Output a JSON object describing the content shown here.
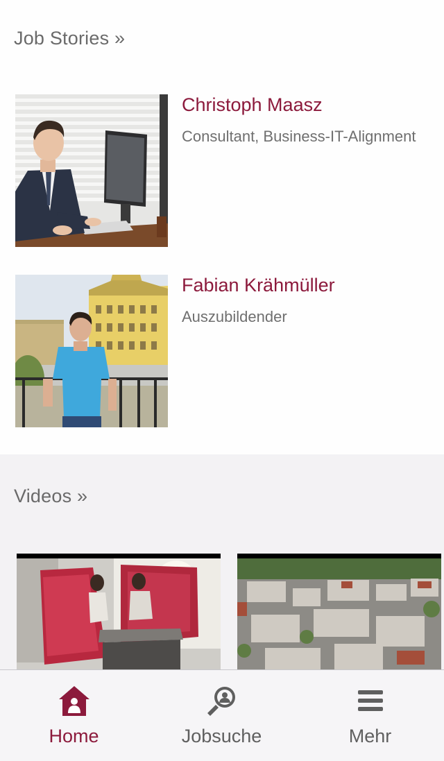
{
  "job_stories": {
    "title": "Job Stories »",
    "items": [
      {
        "name": "Christoph Maasz",
        "role": "Consultant, Business-IT-Alignment"
      },
      {
        "name": "Fabian Krähmüller",
        "role": "Auszubildender"
      }
    ]
  },
  "videos": {
    "title": "Videos »"
  },
  "tabbar": {
    "tabs": [
      {
        "label": "Home",
        "icon": "home-icon",
        "active": true
      },
      {
        "label": "Jobsuche",
        "icon": "search-person-icon",
        "active": false
      },
      {
        "label": "Mehr",
        "icon": "hamburger-menu-icon",
        "active": false
      }
    ]
  },
  "colors": {
    "accent": "#8c1a3c",
    "text_gray": "#6a6a6a",
    "section_bg": "#f3f2f4",
    "tabbar_bg": "#f6f5f7"
  }
}
